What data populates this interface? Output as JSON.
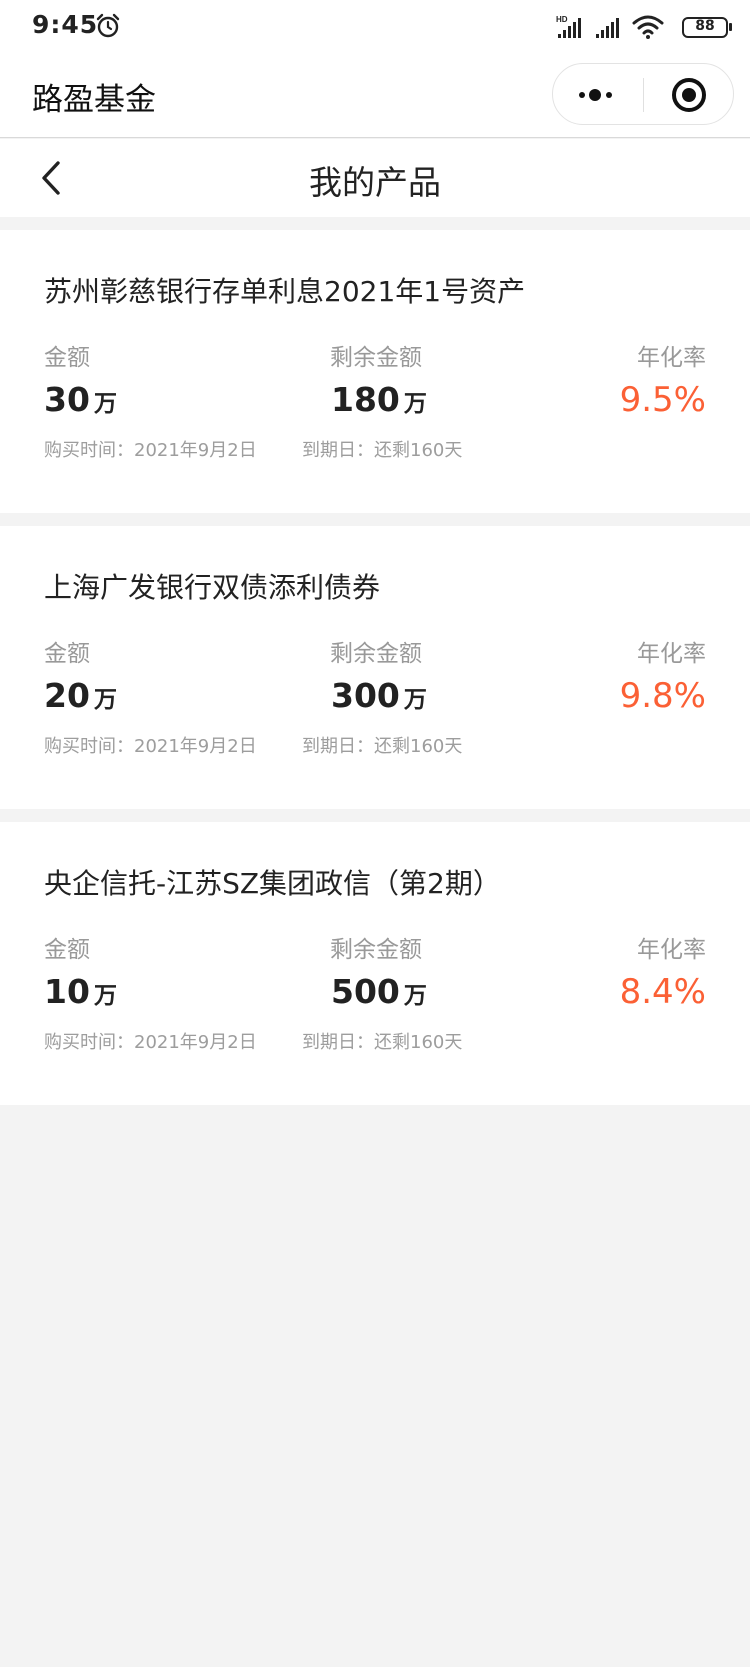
{
  "status_bar": {
    "time": "9:45",
    "battery": "88"
  },
  "app_bar": {
    "title": "路盈基金"
  },
  "page": {
    "title": "我的产品"
  },
  "labels": {
    "amount": "金额",
    "remaining": "剩余金额",
    "rate": "年化率",
    "unit": "万"
  },
  "products": [
    {
      "name": "苏州彰慈银行存单利息2021年1号资产",
      "amount": "30",
      "remaining": "180",
      "rate": "9.5%",
      "purchase_time": "购买时间：2021年9月2日",
      "due": "到期日：还剩160天"
    },
    {
      "name": "上海广发银行双债添利债券",
      "amount": "20",
      "remaining": "300",
      "rate": "9.8%",
      "purchase_time": "购买时间：2021年9月2日",
      "due": "到期日：还剩160天"
    },
    {
      "name": "央企信托-江苏SZ集团政信（第2期）",
      "amount": "10",
      "remaining": "500",
      "rate": "8.4%",
      "purchase_time": "购买时间：2021年9月2日",
      "due": "到期日：还剩160天"
    }
  ],
  "colors": {
    "rate": "#fb6035",
    "background": "#f3f3f3"
  }
}
